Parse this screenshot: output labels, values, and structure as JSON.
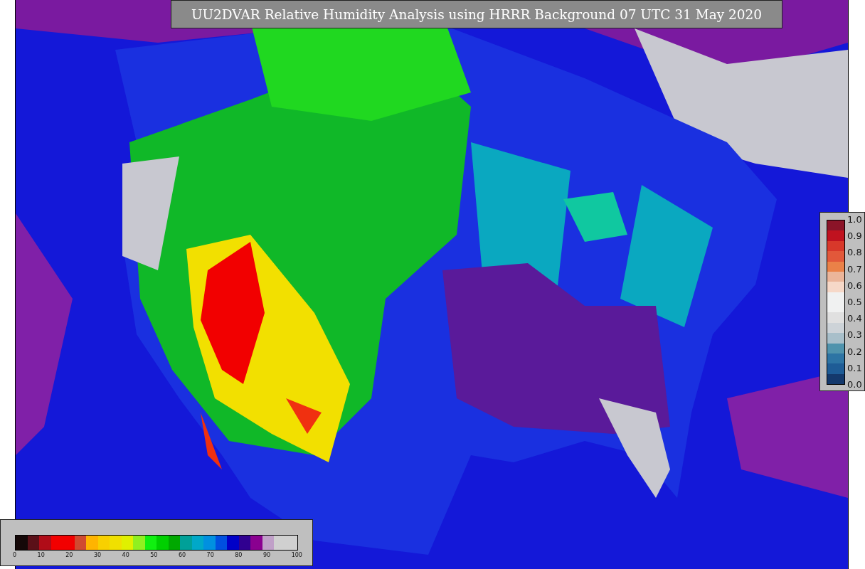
{
  "title": "UU2DVAR Relative Humidity Analysis using HRRR Background 07 UTC 31 May 2020",
  "difference_colorbar": {
    "ticks": [
      "1.0",
      "0.9",
      "0.8",
      "0.7",
      "0.6",
      "0.5",
      "0.4",
      "0.3",
      "0.2",
      "0.1",
      "0.0"
    ],
    "segments": [
      {
        "color": "#8b1428"
      },
      {
        "color": "#c0121f"
      },
      {
        "color": "#d8382a"
      },
      {
        "color": "#e2583a"
      },
      {
        "color": "#ea8148"
      },
      {
        "color": "#ebb59a"
      },
      {
        "color": "#f6d8c8"
      },
      {
        "color": "#f0f1f1"
      },
      {
        "color": "#f0f1f1"
      },
      {
        "color": "#e0e0e0"
      },
      {
        "color": "#cdd3d8"
      },
      {
        "color": "#a8bfca"
      },
      {
        "color": "#4f93ad"
      },
      {
        "color": "#2d74a4"
      },
      {
        "color": "#1e5c96"
      },
      {
        "color": "#14396c"
      }
    ]
  },
  "humidity_colorbar": {
    "ticks": [
      "0",
      "10",
      "20",
      "30",
      "40",
      "50",
      "60",
      "70",
      "80",
      "90",
      "100"
    ],
    "segments": [
      {
        "color": "#150808"
      },
      {
        "color": "#5a1018"
      },
      {
        "color": "#b00c18"
      },
      {
        "color": "#f20000"
      },
      {
        "color": "#f20000"
      },
      {
        "color": "#d04a30"
      },
      {
        "color": "#ffb400"
      },
      {
        "color": "#f8d000"
      },
      {
        "color": "#f0e000"
      },
      {
        "color": "#e0f000"
      },
      {
        "color": "#90f020"
      },
      {
        "color": "#10f010"
      },
      {
        "color": "#00d000"
      },
      {
        "color": "#00a800"
      },
      {
        "color": "#00a098"
      },
      {
        "color": "#00a8c8"
      },
      {
        "color": "#0090e0"
      },
      {
        "color": "#0050e0"
      },
      {
        "color": "#0000c8"
      },
      {
        "color": "#300090"
      },
      {
        "color": "#8a0090"
      },
      {
        "color": "#c0a0c8"
      },
      {
        "color": "#d0d0d0"
      },
      {
        "color": "#d0d0d0"
      }
    ]
  }
}
